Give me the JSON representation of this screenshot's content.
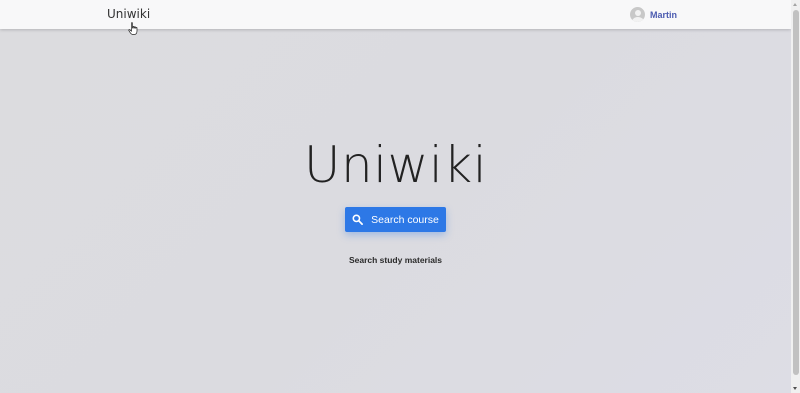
{
  "navbar": {
    "brand": "Uniwiki",
    "user": {
      "name": "Martin",
      "avatar_icon": "user-avatar-icon"
    }
  },
  "hero": {
    "title": "Uniwiki",
    "search_button": {
      "label": "Search course",
      "icon": "search-icon"
    },
    "subtitle": "Search study materials"
  },
  "colors": {
    "accent": "#2d78e6",
    "user_link": "#4b5bb0",
    "navbar_bg": "#f8f8f9",
    "page_bg": "#dcdce1"
  }
}
